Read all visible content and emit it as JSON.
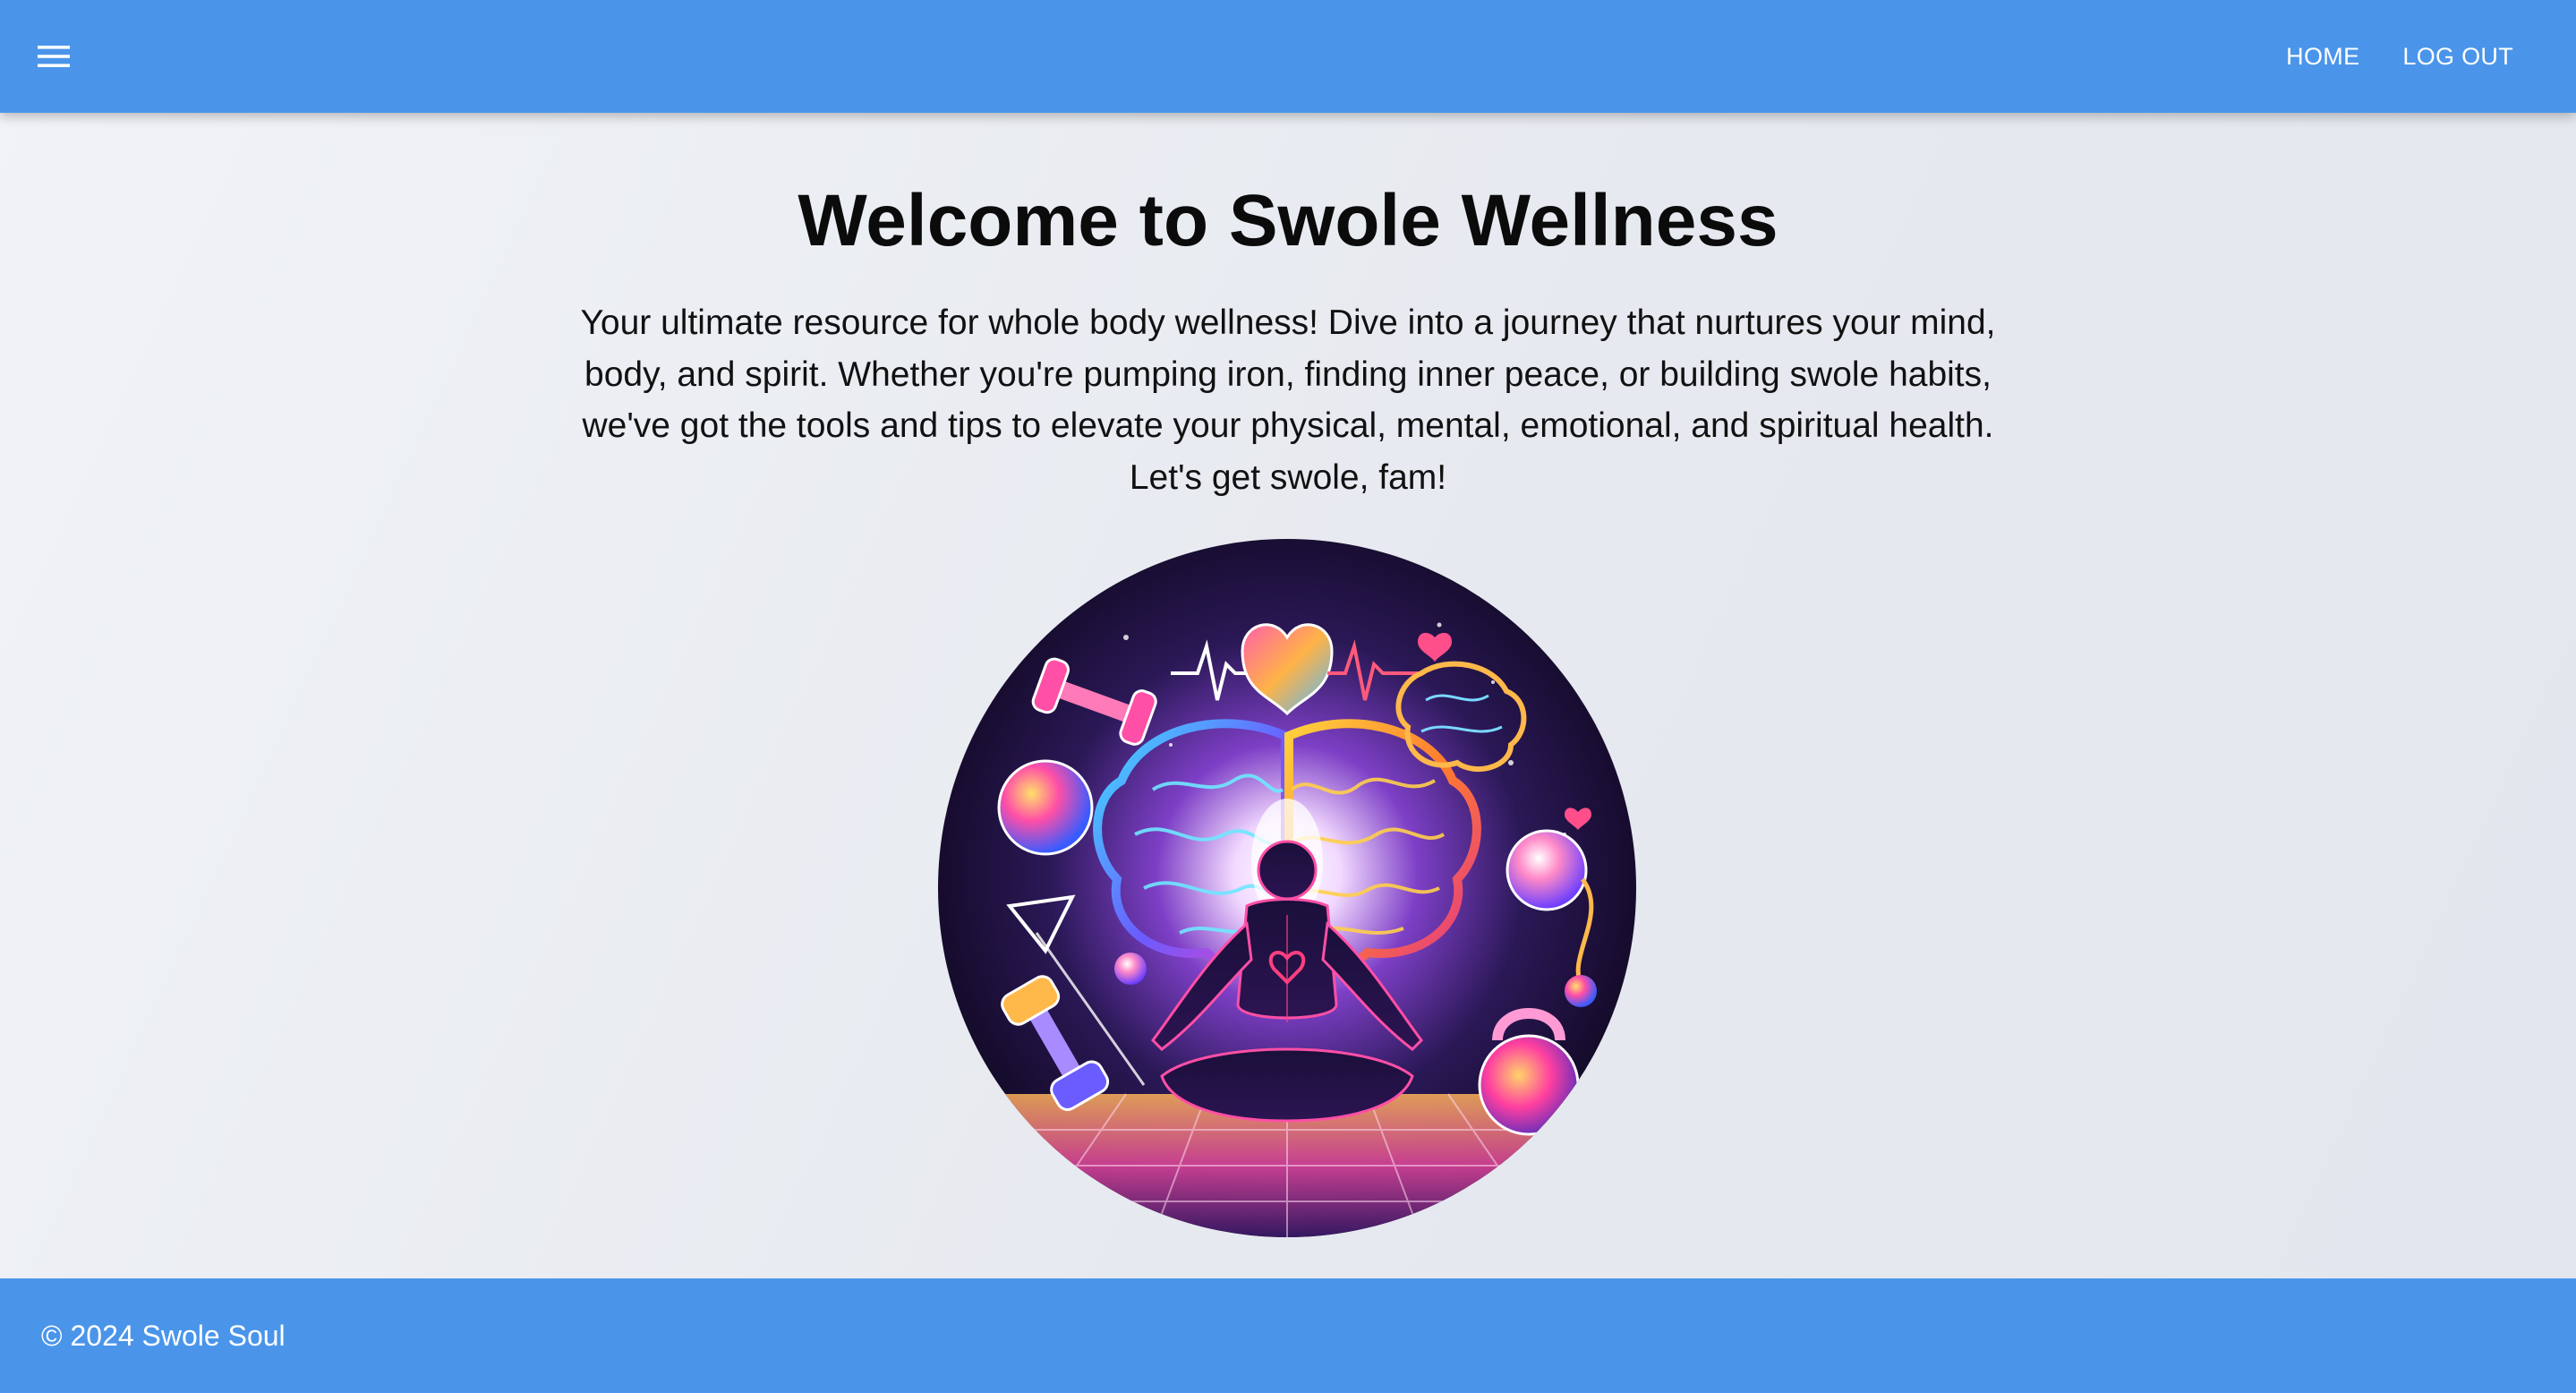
{
  "header": {
    "menu_icon": "hamburger-menu-icon",
    "nav": [
      {
        "label": "HOME"
      },
      {
        "label": "LOG OUT"
      }
    ]
  },
  "main": {
    "title": "Welcome to Swole Wellness",
    "intro": "Your ultimate resource for whole body wellness! Dive into a journey that nurtures your mind, body, and spirit. Whether you're pumping iron, finding inner peace, or building swole habits, we've got the tools and tips to elevate your physical, mental, emotional, and spiritual health. Let's get swole, fam!",
    "hero_image": "wellness-illustration"
  },
  "footer": {
    "copyright": "© 2024 Swole Soul"
  },
  "colors": {
    "primary": "#4a95ea",
    "nav_text": "#ffffff",
    "title_text": "#0b0b0b",
    "background": "#e8ebf1"
  }
}
